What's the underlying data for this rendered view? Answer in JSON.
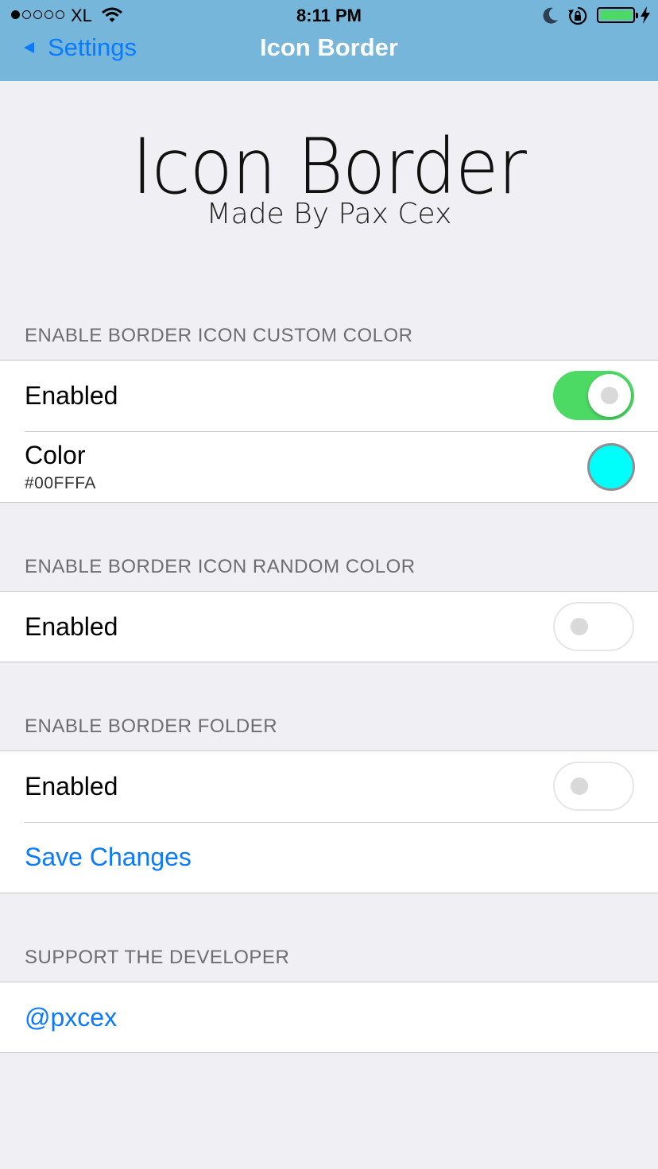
{
  "status_bar": {
    "carrier": "XL",
    "time": "8:11 PM",
    "signal_bars_filled": 1,
    "signal_bars_total": 5,
    "battery_level": 1.0
  },
  "nav": {
    "back_label": "Settings",
    "title": "Icon Border"
  },
  "banner": {
    "title": "Icon Border",
    "subtitle": "Made By Pax Cex"
  },
  "sections": [
    {
      "header": "ENABLE BORDER ICON CUSTOM COLOR",
      "enabled_label": "Enabled",
      "enabled": true,
      "color_label": "Color",
      "color_value": "#00FFFA"
    },
    {
      "header": "ENABLE BORDER ICON RANDOM COLOR",
      "enabled_label": "Enabled",
      "enabled": false
    },
    {
      "header": "ENABLE BORDER FOLDER",
      "enabled_label": "Enabled",
      "enabled": false,
      "action_label": "Save Changes"
    },
    {
      "header": "SUPPORT THE DEVELOPER",
      "link_label": "@pxcex"
    }
  ],
  "colors": {
    "nav_bar": "#76b6da",
    "tint": "#0a7aff",
    "toggle_on": "#4cd964",
    "swatch": "#00FFFA"
  }
}
